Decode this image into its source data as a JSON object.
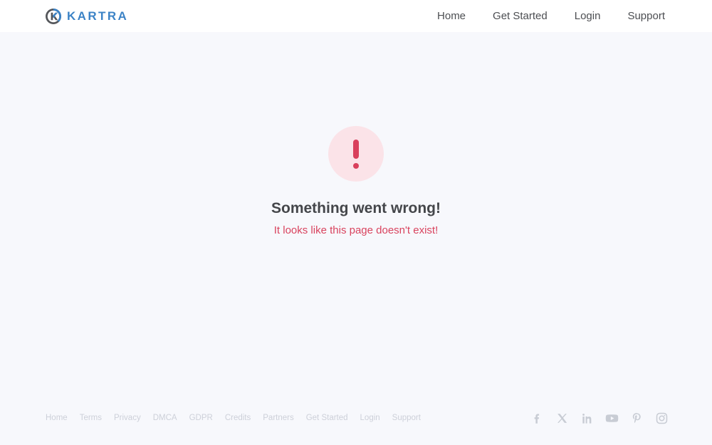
{
  "header": {
    "brand": {
      "name": "KARTRA",
      "mark_icon": "kartra-k-circle-icon",
      "mark_dark_color": "#54565a",
      "mark_blue_color": "#3c83c6",
      "word_color": "#3c83c6"
    },
    "nav": [
      {
        "label": "Home"
      },
      {
        "label": "Get Started"
      },
      {
        "label": "Login"
      },
      {
        "label": "Support"
      }
    ]
  },
  "main": {
    "icon": "exclamation-mark-icon",
    "icon_circle_color": "#fbe3e8",
    "icon_mark_color": "#d9405c",
    "title": "Something went wrong!",
    "subtitle": "It looks like this page doesn't exist!",
    "title_color": "#44464a",
    "subtitle_color": "#d9435e"
  },
  "footer": {
    "links": [
      {
        "label": "Home"
      },
      {
        "label": "Terms"
      },
      {
        "label": "Privacy"
      },
      {
        "label": "DMCA"
      },
      {
        "label": "GDPR"
      },
      {
        "label": "Credits"
      },
      {
        "label": "Partners"
      },
      {
        "label": "Get Started"
      },
      {
        "label": "Login"
      },
      {
        "label": "Support"
      }
    ],
    "link_color": "#cdd0d9",
    "socials": [
      {
        "icon": "facebook-icon"
      },
      {
        "icon": "x-twitter-icon"
      },
      {
        "icon": "linkedin-icon"
      },
      {
        "icon": "youtube-icon"
      },
      {
        "icon": "pinterest-icon"
      },
      {
        "icon": "instagram-icon"
      }
    ],
    "social_color": "#c8ccd4"
  },
  "page": {
    "background_color": "#f7f8fc",
    "header_background_color": "#ffffff"
  }
}
